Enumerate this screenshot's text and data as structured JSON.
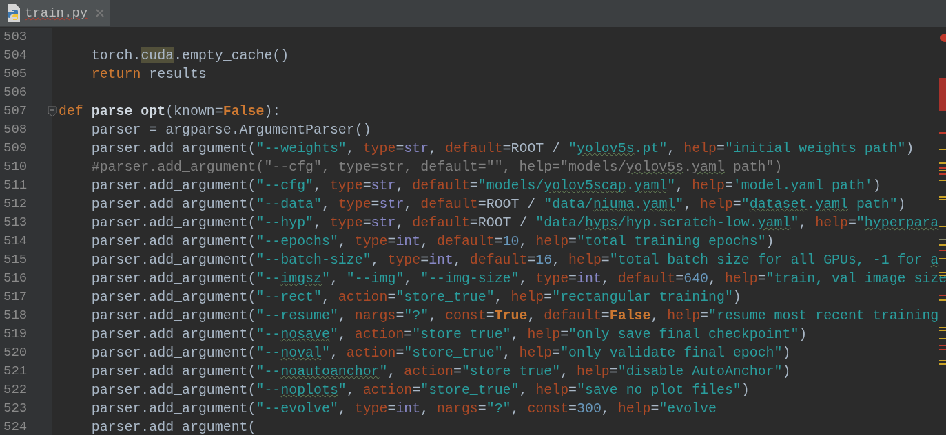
{
  "tabs": [
    {
      "label": "train.py",
      "selected": true,
      "typo": true
    }
  ],
  "editor": {
    "lines": [
      {
        "number": "503"
      },
      {
        "number": "504",
        "tokens": [
          {
            "kind": "p",
            "text": "    torch."
          },
          {
            "kind": "h",
            "text": "cuda"
          },
          {
            "kind": "p",
            "text": ".empty_cache()"
          }
        ]
      },
      {
        "number": "505",
        "tokens": [
          {
            "kind": "k",
            "text": "    return"
          },
          {
            "kind": "p",
            "text": " results"
          }
        ]
      },
      {
        "number": "506"
      },
      {
        "number": "507",
        "fold": true,
        "tokens": [
          {
            "kind": "k",
            "text": "def "
          },
          {
            "kind": "f",
            "text": "parse_opt"
          },
          {
            "kind": "p",
            "text": "(known="
          },
          {
            "kind": "kb",
            "text": "False"
          },
          {
            "kind": "p",
            "text": "):"
          }
        ]
      },
      {
        "number": "508",
        "tokens": [
          {
            "kind": "p",
            "text": "    parser = argparse.ArgumentParser()"
          }
        ]
      },
      {
        "number": "509",
        "tokens": [
          {
            "kind": "p",
            "text": "    parser.add_argument("
          },
          {
            "kind": "s",
            "text": "\"--weights\""
          },
          {
            "kind": "p",
            "text": ", "
          },
          {
            "kind": "kw",
            "text": "type"
          },
          {
            "kind": "p",
            "text": "="
          },
          {
            "kind": "b",
            "text": "str"
          },
          {
            "kind": "p",
            "text": ", "
          },
          {
            "kind": "kw",
            "text": "default"
          },
          {
            "kind": "p",
            "text": "=ROOT / "
          },
          {
            "kind": "s",
            "text": "\""
          },
          {
            "kind": "su",
            "text": "yolov5s"
          },
          {
            "kind": "s",
            "text": ".pt\""
          },
          {
            "kind": "p",
            "text": ", "
          },
          {
            "kind": "kw",
            "text": "help"
          },
          {
            "kind": "p",
            "text": "="
          },
          {
            "kind": "s",
            "text": "\"initial weights path\""
          },
          {
            "kind": "p",
            "text": ")"
          }
        ]
      },
      {
        "number": "510",
        "tokens": [
          {
            "kind": "c",
            "text": "    #parser.add_argument(\"--cfg\", type=str, default=\"\", help=\"models/"
          },
          {
            "kind": "cu",
            "text": "yolov5s"
          },
          {
            "kind": "c",
            "text": "."
          },
          {
            "kind": "cu",
            "text": "yaml"
          },
          {
            "kind": "c",
            "text": " path\")"
          }
        ]
      },
      {
        "number": "511",
        "tokens": [
          {
            "kind": "p",
            "text": "    parser.add_argument("
          },
          {
            "kind": "s",
            "text": "\"--cfg\""
          },
          {
            "kind": "p",
            "text": ", "
          },
          {
            "kind": "kw",
            "text": "type"
          },
          {
            "kind": "p",
            "text": "="
          },
          {
            "kind": "b",
            "text": "str"
          },
          {
            "kind": "p",
            "text": ", "
          },
          {
            "kind": "kw",
            "text": "default"
          },
          {
            "kind": "p",
            "text": "="
          },
          {
            "kind": "s",
            "text": "\"models/"
          },
          {
            "kind": "su",
            "text": "yolov5scap"
          },
          {
            "kind": "s",
            "text": "."
          },
          {
            "kind": "su",
            "text": "yaml"
          },
          {
            "kind": "s",
            "text": "\""
          },
          {
            "kind": "p",
            "text": ", "
          },
          {
            "kind": "kw",
            "text": "help"
          },
          {
            "kind": "p",
            "text": "="
          },
          {
            "kind": "s",
            "text": "'model.yaml path'"
          },
          {
            "kind": "p",
            "text": ")"
          }
        ]
      },
      {
        "number": "512",
        "tokens": [
          {
            "kind": "p",
            "text": "    parser.add_argument("
          },
          {
            "kind": "s",
            "text": "\"--data\""
          },
          {
            "kind": "p",
            "text": ", "
          },
          {
            "kind": "kw",
            "text": "type"
          },
          {
            "kind": "p",
            "text": "="
          },
          {
            "kind": "b",
            "text": "str"
          },
          {
            "kind": "p",
            "text": ", "
          },
          {
            "kind": "kw",
            "text": "default"
          },
          {
            "kind": "p",
            "text": "=ROOT / "
          },
          {
            "kind": "s",
            "text": "\"data/"
          },
          {
            "kind": "su",
            "text": "niuma"
          },
          {
            "kind": "s",
            "text": "."
          },
          {
            "kind": "su",
            "text": "yaml"
          },
          {
            "kind": "s",
            "text": "\""
          },
          {
            "kind": "p",
            "text": ", "
          },
          {
            "kind": "kw",
            "text": "help"
          },
          {
            "kind": "p",
            "text": "="
          },
          {
            "kind": "s",
            "text": "\""
          },
          {
            "kind": "su",
            "text": "dataset"
          },
          {
            "kind": "s",
            "text": "."
          },
          {
            "kind": "su",
            "text": "yaml"
          },
          {
            "kind": "s",
            "text": " path\""
          },
          {
            "kind": "p",
            "text": ")"
          }
        ]
      },
      {
        "number": "513",
        "tokens": [
          {
            "kind": "p",
            "text": "    parser.add_argument("
          },
          {
            "kind": "s",
            "text": "\"--hyp\""
          },
          {
            "kind": "p",
            "text": ", "
          },
          {
            "kind": "kw",
            "text": "type"
          },
          {
            "kind": "p",
            "text": "="
          },
          {
            "kind": "b",
            "text": "str"
          },
          {
            "kind": "p",
            "text": ", "
          },
          {
            "kind": "kw",
            "text": "default"
          },
          {
            "kind": "p",
            "text": "=ROOT / "
          },
          {
            "kind": "s",
            "text": "\"data/"
          },
          {
            "kind": "su",
            "text": "hyps"
          },
          {
            "kind": "s",
            "text": "/hyp.scratch-low."
          },
          {
            "kind": "su",
            "text": "yaml"
          },
          {
            "kind": "s",
            "text": "\""
          },
          {
            "kind": "p",
            "text": ", "
          },
          {
            "kind": "kw",
            "text": "help"
          },
          {
            "kind": "p",
            "text": "="
          },
          {
            "kind": "s",
            "text": "\""
          },
          {
            "kind": "su",
            "text": "hyperpara"
          }
        ]
      },
      {
        "number": "514",
        "tokens": [
          {
            "kind": "p",
            "text": "    parser.add_argument("
          },
          {
            "kind": "s",
            "text": "\"--epochs\""
          },
          {
            "kind": "p",
            "text": ", "
          },
          {
            "kind": "kw",
            "text": "type"
          },
          {
            "kind": "p",
            "text": "="
          },
          {
            "kind": "b",
            "text": "int"
          },
          {
            "kind": "p",
            "text": ", "
          },
          {
            "kind": "kw",
            "text": "default"
          },
          {
            "kind": "p",
            "text": "="
          },
          {
            "kind": "n",
            "text": "10"
          },
          {
            "kind": "p",
            "text": ", "
          },
          {
            "kind": "kw",
            "text": "help"
          },
          {
            "kind": "p",
            "text": "="
          },
          {
            "kind": "s",
            "text": "\"total training epochs\""
          },
          {
            "kind": "p",
            "text": ")"
          }
        ]
      },
      {
        "number": "515",
        "tokens": [
          {
            "kind": "p",
            "text": "    parser.add_argument("
          },
          {
            "kind": "s",
            "text": "\"--batch-size\""
          },
          {
            "kind": "p",
            "text": ", "
          },
          {
            "kind": "kw",
            "text": "type"
          },
          {
            "kind": "p",
            "text": "="
          },
          {
            "kind": "b",
            "text": "int"
          },
          {
            "kind": "p",
            "text": ", "
          },
          {
            "kind": "kw",
            "text": "default"
          },
          {
            "kind": "p",
            "text": "="
          },
          {
            "kind": "n",
            "text": "16"
          },
          {
            "kind": "p",
            "text": ", "
          },
          {
            "kind": "kw",
            "text": "help"
          },
          {
            "kind": "p",
            "text": "="
          },
          {
            "kind": "s",
            "text": "\"total batch size for all GPUs, -1 for "
          },
          {
            "kind": "su",
            "text": "a"
          }
        ]
      },
      {
        "number": "516",
        "tokens": [
          {
            "kind": "p",
            "text": "    parser.add_argument("
          },
          {
            "kind": "s",
            "text": "\"--"
          },
          {
            "kind": "su",
            "text": "imgsz"
          },
          {
            "kind": "s",
            "text": "\""
          },
          {
            "kind": "p",
            "text": ", "
          },
          {
            "kind": "s",
            "text": "\"--img\""
          },
          {
            "kind": "p",
            "text": ", "
          },
          {
            "kind": "s",
            "text": "\"--img-size\""
          },
          {
            "kind": "p",
            "text": ", "
          },
          {
            "kind": "kw",
            "text": "type"
          },
          {
            "kind": "p",
            "text": "="
          },
          {
            "kind": "b",
            "text": "int"
          },
          {
            "kind": "p",
            "text": ", "
          },
          {
            "kind": "kw",
            "text": "default"
          },
          {
            "kind": "p",
            "text": "="
          },
          {
            "kind": "n",
            "text": "640"
          },
          {
            "kind": "p",
            "text": ", "
          },
          {
            "kind": "kw",
            "text": "help"
          },
          {
            "kind": "p",
            "text": "="
          },
          {
            "kind": "s",
            "text": "\"train, val image size"
          }
        ]
      },
      {
        "number": "517",
        "tokens": [
          {
            "kind": "p",
            "text": "    parser.add_argument("
          },
          {
            "kind": "s",
            "text": "\"--rect\""
          },
          {
            "kind": "p",
            "text": ", "
          },
          {
            "kind": "kw",
            "text": "action"
          },
          {
            "kind": "p",
            "text": "="
          },
          {
            "kind": "s",
            "text": "\"store_true\""
          },
          {
            "kind": "p",
            "text": ", "
          },
          {
            "kind": "kw",
            "text": "help"
          },
          {
            "kind": "p",
            "text": "="
          },
          {
            "kind": "s",
            "text": "\"rectangular training\""
          },
          {
            "kind": "p",
            "text": ")"
          }
        ]
      },
      {
        "number": "518",
        "tokens": [
          {
            "kind": "p",
            "text": "    parser.add_argument("
          },
          {
            "kind": "s",
            "text": "\"--resume\""
          },
          {
            "kind": "p",
            "text": ", "
          },
          {
            "kind": "kw",
            "text": "nargs"
          },
          {
            "kind": "p",
            "text": "="
          },
          {
            "kind": "s",
            "text": "\"?\""
          },
          {
            "kind": "p",
            "text": ", "
          },
          {
            "kind": "kw",
            "text": "const"
          },
          {
            "kind": "p",
            "text": "="
          },
          {
            "kind": "kb",
            "text": "True"
          },
          {
            "kind": "p",
            "text": ", "
          },
          {
            "kind": "kw",
            "text": "default"
          },
          {
            "kind": "p",
            "text": "="
          },
          {
            "kind": "kb",
            "text": "False"
          },
          {
            "kind": "p",
            "text": ", "
          },
          {
            "kind": "kw",
            "text": "help"
          },
          {
            "kind": "p",
            "text": "="
          },
          {
            "kind": "s",
            "text": "\"resume most recent training"
          }
        ]
      },
      {
        "number": "519",
        "tokens": [
          {
            "kind": "p",
            "text": "    parser.add_argument("
          },
          {
            "kind": "s",
            "text": "\"--"
          },
          {
            "kind": "su",
            "text": "nosave"
          },
          {
            "kind": "s",
            "text": "\""
          },
          {
            "kind": "p",
            "text": ", "
          },
          {
            "kind": "kw",
            "text": "action"
          },
          {
            "kind": "p",
            "text": "="
          },
          {
            "kind": "s",
            "text": "\"store_true\""
          },
          {
            "kind": "p",
            "text": ", "
          },
          {
            "kind": "kw",
            "text": "help"
          },
          {
            "kind": "p",
            "text": "="
          },
          {
            "kind": "s",
            "text": "\"only save final checkpoint\""
          },
          {
            "kind": "p",
            "text": ")"
          }
        ]
      },
      {
        "number": "520",
        "tokens": [
          {
            "kind": "p",
            "text": "    parser.add_argument("
          },
          {
            "kind": "s",
            "text": "\"--"
          },
          {
            "kind": "su",
            "text": "noval"
          },
          {
            "kind": "s",
            "text": "\""
          },
          {
            "kind": "p",
            "text": ", "
          },
          {
            "kind": "kw",
            "text": "action"
          },
          {
            "kind": "p",
            "text": "="
          },
          {
            "kind": "s",
            "text": "\"store_true\""
          },
          {
            "kind": "p",
            "text": ", "
          },
          {
            "kind": "kw",
            "text": "help"
          },
          {
            "kind": "p",
            "text": "="
          },
          {
            "kind": "s",
            "text": "\"only validate final epoch\""
          },
          {
            "kind": "p",
            "text": ")"
          }
        ]
      },
      {
        "number": "521",
        "tokens": [
          {
            "kind": "p",
            "text": "    parser.add_argument("
          },
          {
            "kind": "s",
            "text": "\"--"
          },
          {
            "kind": "su",
            "text": "noautoanchor"
          },
          {
            "kind": "s",
            "text": "\""
          },
          {
            "kind": "p",
            "text": ", "
          },
          {
            "kind": "kw",
            "text": "action"
          },
          {
            "kind": "p",
            "text": "="
          },
          {
            "kind": "s",
            "text": "\"store_true\""
          },
          {
            "kind": "p",
            "text": ", "
          },
          {
            "kind": "kw",
            "text": "help"
          },
          {
            "kind": "p",
            "text": "="
          },
          {
            "kind": "s",
            "text": "\"disable AutoAnchor\""
          },
          {
            "kind": "p",
            "text": ")"
          }
        ]
      },
      {
        "number": "522",
        "tokens": [
          {
            "kind": "p",
            "text": "    parser.add_argument("
          },
          {
            "kind": "s",
            "text": "\"--"
          },
          {
            "kind": "su",
            "text": "noplots"
          },
          {
            "kind": "s",
            "text": "\""
          },
          {
            "kind": "p",
            "text": ", "
          },
          {
            "kind": "kw",
            "text": "action"
          },
          {
            "kind": "p",
            "text": "="
          },
          {
            "kind": "s",
            "text": "\"store_true\""
          },
          {
            "kind": "p",
            "text": ", "
          },
          {
            "kind": "kw",
            "text": "help"
          },
          {
            "kind": "p",
            "text": "="
          },
          {
            "kind": "s",
            "text": "\"save no plot files\""
          },
          {
            "kind": "p",
            "text": ")"
          }
        ]
      },
      {
        "number": "523",
        "tokens": [
          {
            "kind": "p",
            "text": "    parser.add_argument("
          },
          {
            "kind": "s",
            "text": "\"--evolve\""
          },
          {
            "kind": "p",
            "text": ", "
          },
          {
            "kind": "kw",
            "text": "type"
          },
          {
            "kind": "p",
            "text": "="
          },
          {
            "kind": "b",
            "text": "int"
          },
          {
            "kind": "p",
            "text": ", "
          },
          {
            "kind": "kw",
            "text": "nargs"
          },
          {
            "kind": "p",
            "text": "="
          },
          {
            "kind": "s",
            "text": "\"?\""
          },
          {
            "kind": "p",
            "text": ", "
          },
          {
            "kind": "kw",
            "text": "const"
          },
          {
            "kind": "p",
            "text": "="
          },
          {
            "kind": "n",
            "text": "300"
          },
          {
            "kind": "p",
            "text": ", "
          },
          {
            "kind": "kw",
            "text": "help"
          },
          {
            "kind": "p",
            "text": "="
          },
          {
            "kind": "s",
            "text": "\"evolve"
          }
        ]
      },
      {
        "number": "524",
        "tokens": [
          {
            "kind": "p",
            "text": "    parser.add_argument("
          }
        ]
      }
    ]
  }
}
